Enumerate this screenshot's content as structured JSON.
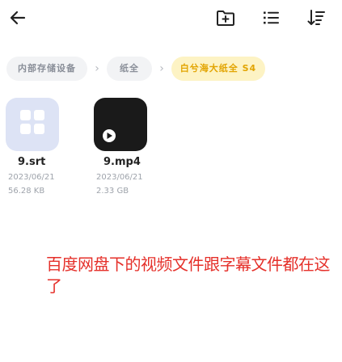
{
  "toolbar": {
    "back_icon": "arrow-left-icon",
    "add_folder_icon": "folder-plus-icon",
    "list_view_icon": "list-view-icon",
    "sort_icon": "sort-icon"
  },
  "breadcrumb": {
    "items": [
      {
        "label": "内部存储设备"
      },
      {
        "label": "纸全"
      },
      {
        "label": "白兮海大纸全 S4"
      }
    ],
    "separator": "›"
  },
  "files": [
    {
      "name": "9.srt",
      "date": "2023/06/21",
      "size": "56.28 KB",
      "icon": "subtitle-file-icon",
      "thumb_color": "#dde3f5"
    },
    {
      "name": "9.mp4",
      "date": "2023/06/21",
      "size": "2.33 GB",
      "icon": "video-file-icon",
      "thumb_color": "#1a1a1a"
    }
  ],
  "annotation": {
    "text": "百度网盘下的视频文件跟字幕文件都在这了",
    "color": "#e5302a"
  },
  "colors": {
    "breadcrumb_bg": "#f2f3f5",
    "breadcrumb_active_bg": "#fdf3c4",
    "breadcrumb_active_text": "#e2a400"
  }
}
